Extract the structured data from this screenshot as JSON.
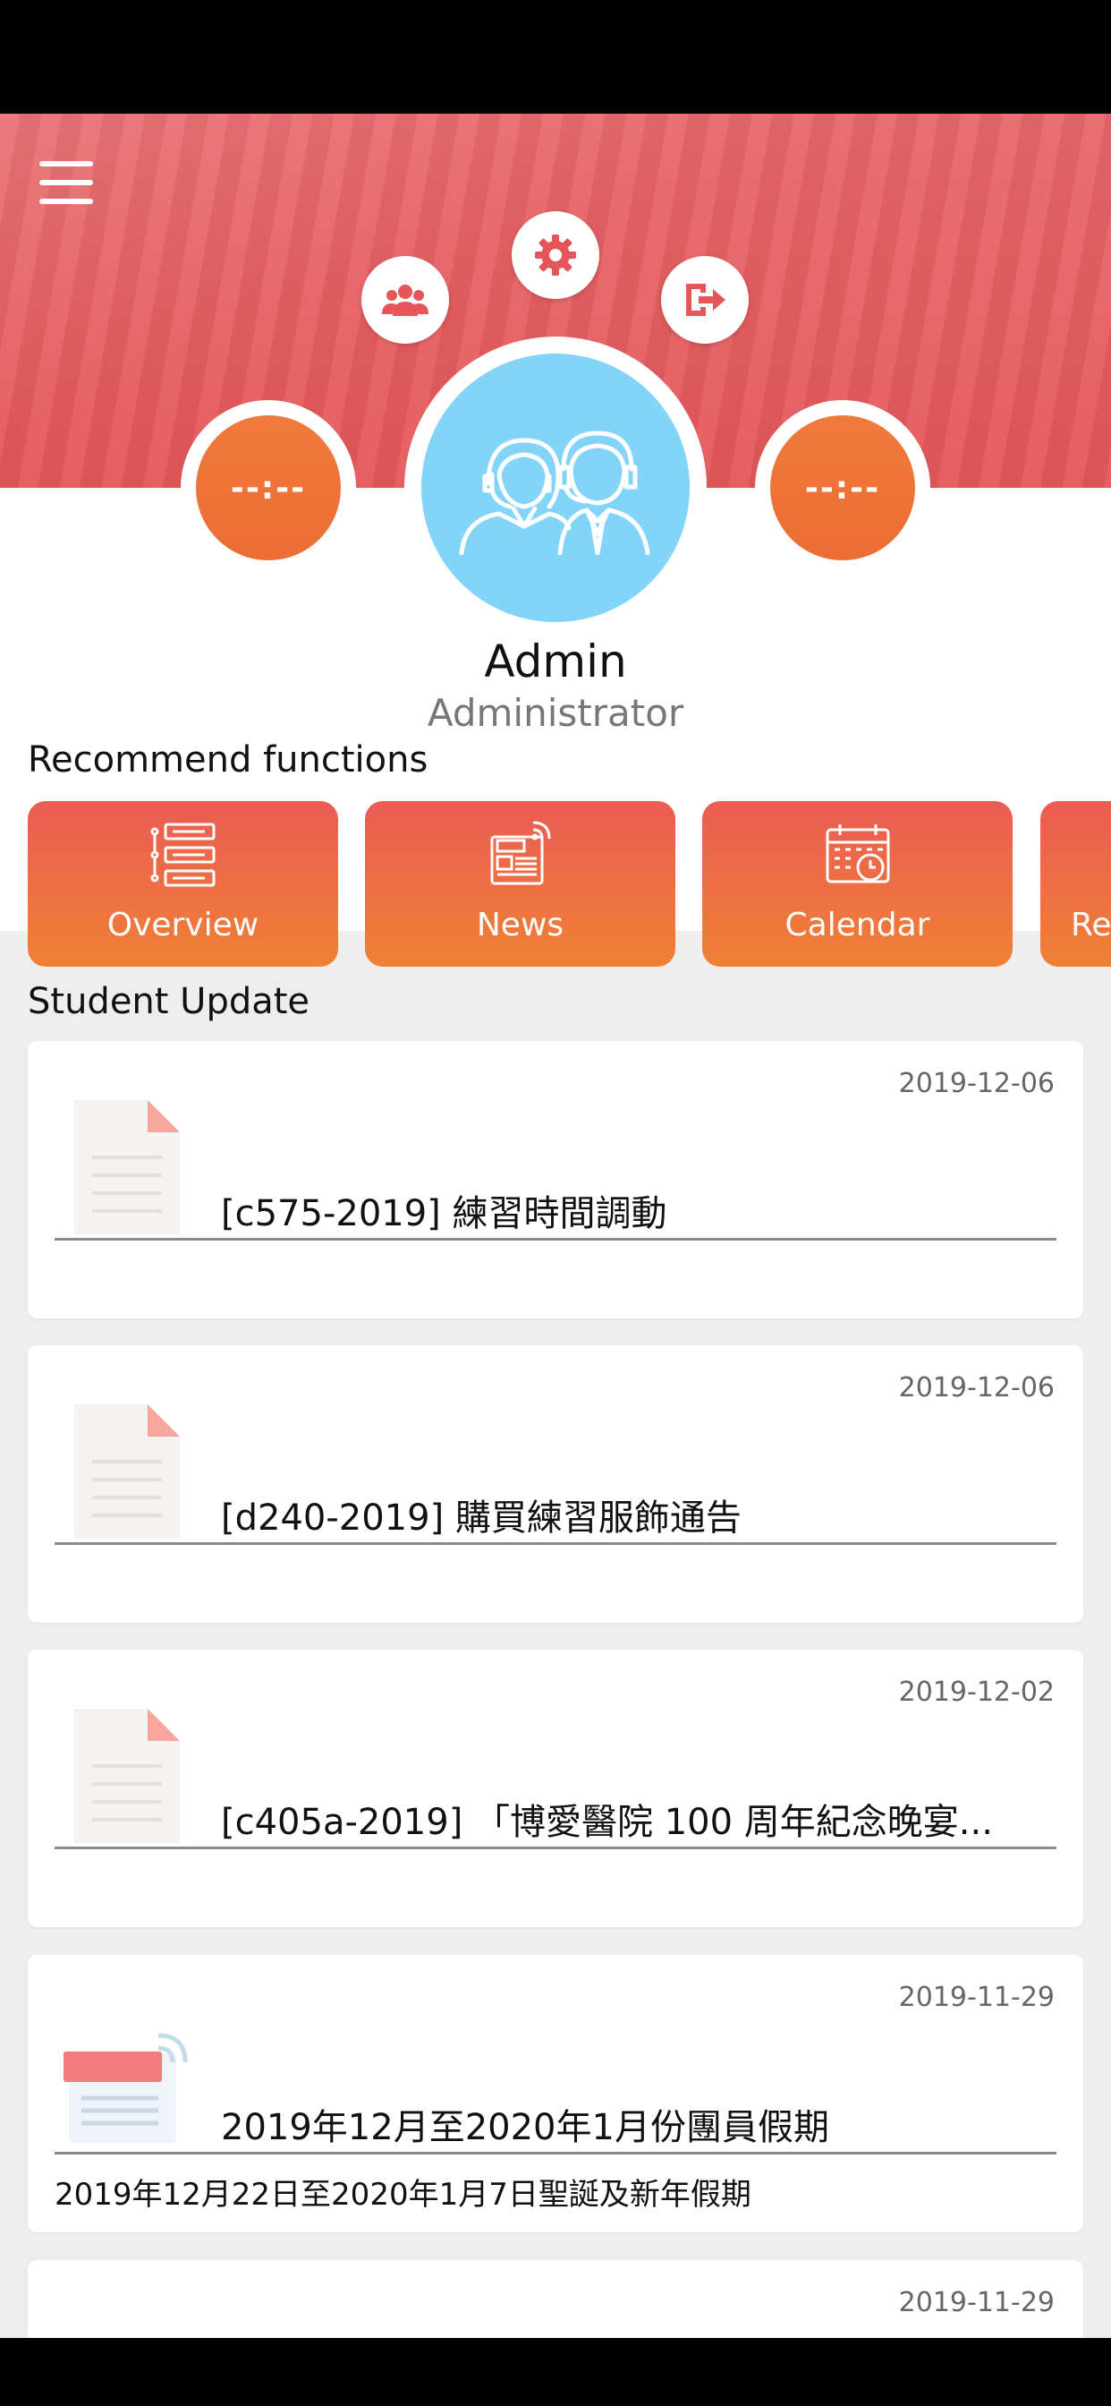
{
  "header": {
    "left_time": "--:--",
    "right_time": "--:--"
  },
  "user": {
    "name": "Admin",
    "role": "Administrator"
  },
  "recommend": {
    "title": "Recommend functions",
    "items": [
      {
        "label": "Overview",
        "icon": "overview-icon"
      },
      {
        "label": "News",
        "icon": "news-icon"
      },
      {
        "label": "Calendar",
        "icon": "calendar-icon"
      },
      {
        "label": "Re",
        "icon": "partial-icon"
      }
    ]
  },
  "updates": {
    "title": "Student Update",
    "items": [
      {
        "date": "2019-12-06",
        "title": "[c575-2019] 練習時間調動",
        "body": "",
        "icon": "document-icon"
      },
      {
        "date": "2019-12-06",
        "title": "[d240-2019] 購買練習服飾通告",
        "body": "",
        "icon": "document-icon"
      },
      {
        "date": "2019-12-02",
        "title": "[c405a-2019] 「博愛醫院 100 周年紀念晚宴...",
        "body": "",
        "icon": "document-icon"
      },
      {
        "date": "2019-11-29",
        "title": "2019年12月至2020年1月份團員假期",
        "body": "2019年12月22日至2020年1月7日聖誕及新年假期",
        "icon": "news-icon"
      },
      {
        "date": "2019-11-29",
        "title": "",
        "body": "",
        "icon": "news-icon"
      }
    ]
  },
  "colors": {
    "header": "#e4585a",
    "tile_top": "#ea5c54",
    "tile_bottom": "#ef8134",
    "avatar_bg": "#82d4f8",
    "time_circle": "#ec6d35"
  }
}
